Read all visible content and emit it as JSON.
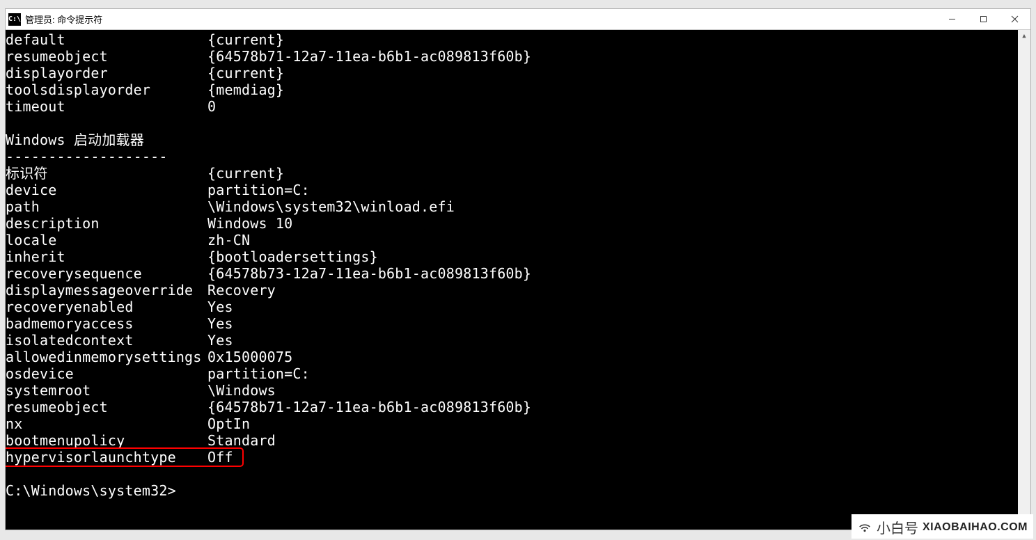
{
  "window": {
    "title": "管理员: 命令提示符"
  },
  "bootmgr": {
    "rows": [
      {
        "k": "default",
        "v": "{current}"
      },
      {
        "k": "resumeobject",
        "v": "{64578b71-12a7-11ea-b6b1-ac089813f60b}"
      },
      {
        "k": "displayorder",
        "v": "{current}"
      },
      {
        "k": "toolsdisplayorder",
        "v": "{memdiag}"
      },
      {
        "k": "timeout",
        "v": "0"
      }
    ]
  },
  "loader": {
    "section_title": "Windows 启动加载器",
    "section_underline": "-------------------",
    "rows": [
      {
        "k": "标识符",
        "v": "{current}"
      },
      {
        "k": "device",
        "v": "partition=C:"
      },
      {
        "k": "path",
        "v": "\\Windows\\system32\\winload.efi"
      },
      {
        "k": "description",
        "v": "Windows 10"
      },
      {
        "k": "locale",
        "v": "zh-CN"
      },
      {
        "k": "inherit",
        "v": "{bootloadersettings}"
      },
      {
        "k": "recoverysequence",
        "v": "{64578b73-12a7-11ea-b6b1-ac089813f60b}"
      },
      {
        "k": "displaymessageoverride",
        "v": "Recovery"
      },
      {
        "k": "recoveryenabled",
        "v": "Yes"
      },
      {
        "k": "badmemoryaccess",
        "v": "Yes"
      },
      {
        "k": "isolatedcontext",
        "v": "Yes"
      },
      {
        "k": "allowedinmemorysettings",
        "v": "0x15000075"
      },
      {
        "k": "osdevice",
        "v": "partition=C:"
      },
      {
        "k": "systemroot",
        "v": "\\Windows"
      },
      {
        "k": "resumeobject",
        "v": "{64578b71-12a7-11ea-b6b1-ac089813f60b}"
      },
      {
        "k": "nx",
        "v": "OptIn"
      },
      {
        "k": "bootmenupolicy",
        "v": "Standard"
      },
      {
        "k": "hypervisorlaunchtype",
        "v": "Off"
      }
    ]
  },
  "prompt": "C:\\Windows\\system32>",
  "highlight_row_index": 17,
  "brand": {
    "cn": "小白号",
    "en": "XIAOBAIHAO.COM"
  }
}
